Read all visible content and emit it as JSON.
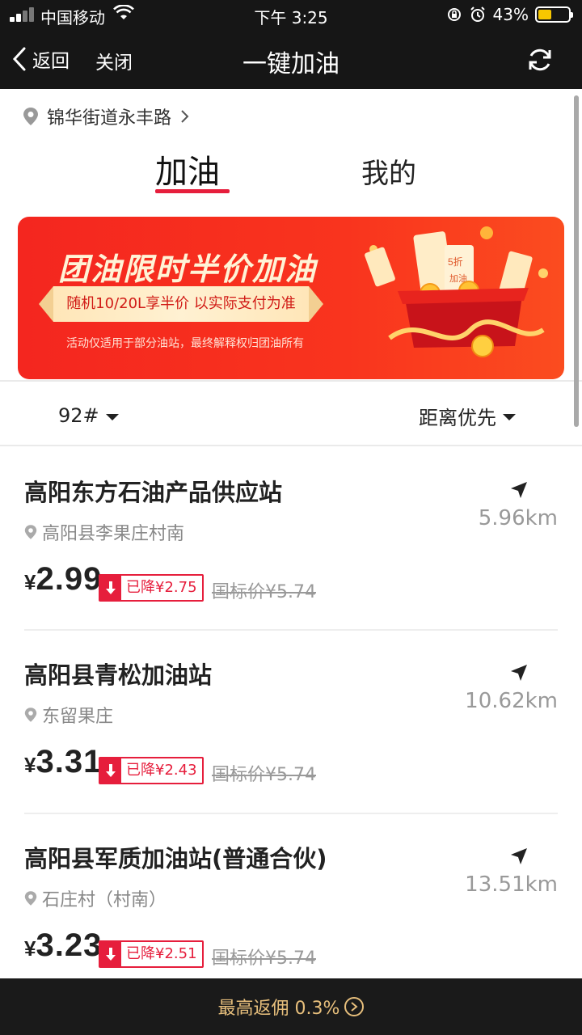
{
  "status_bar": {
    "carrier": "中国移动",
    "time": "下午 3:25",
    "battery": "43%",
    "battery_level": 0.43
  },
  "nav": {
    "back_label": "返回",
    "close_label": "关闭",
    "title": "一键加油"
  },
  "location": "锦华街道永丰路",
  "tabs": [
    {
      "label": "加油",
      "active": true
    },
    {
      "label": "我的",
      "active": false
    }
  ],
  "banner": {
    "title": "团油限时半价加油",
    "subtitle": "随机10/20L享半价 以实际支付为准",
    "note": "活动仅适用于部分油站，最终解释权归团油所有",
    "coupon_text_1": "5折",
    "coupon_text_2": "加油"
  },
  "filters": {
    "fuel": "92#",
    "sort": "距离优先"
  },
  "stations": [
    {
      "name": "高阳东方石油产品供应站",
      "address": "高阳县李果庄村南",
      "distance": "5.96km",
      "currency": "¥",
      "price": "2.99",
      "discount": "已降¥2.75",
      "list_price": "国标价¥5.74"
    },
    {
      "name": "高阳县青松加油站",
      "address": "东留果庄",
      "distance": "10.62km",
      "currency": "¥",
      "price": "3.31",
      "discount": "已降¥2.43",
      "list_price": "国标价¥5.74"
    },
    {
      "name": "高阳县军质加油站(普通合伙)",
      "address": "石庄村（村南）",
      "distance": "13.51km",
      "currency": "¥",
      "price": "3.23",
      "discount": "已降¥2.51",
      "list_price": "国标价¥5.74"
    }
  ],
  "bottom_bar": {
    "label": "最高返佣 0.3%"
  },
  "colors": {
    "accent": "#e61e3c",
    "nav_bg": "#161616",
    "bottom_text": "#e7bf7c",
    "banner_red": "#f4261f"
  }
}
